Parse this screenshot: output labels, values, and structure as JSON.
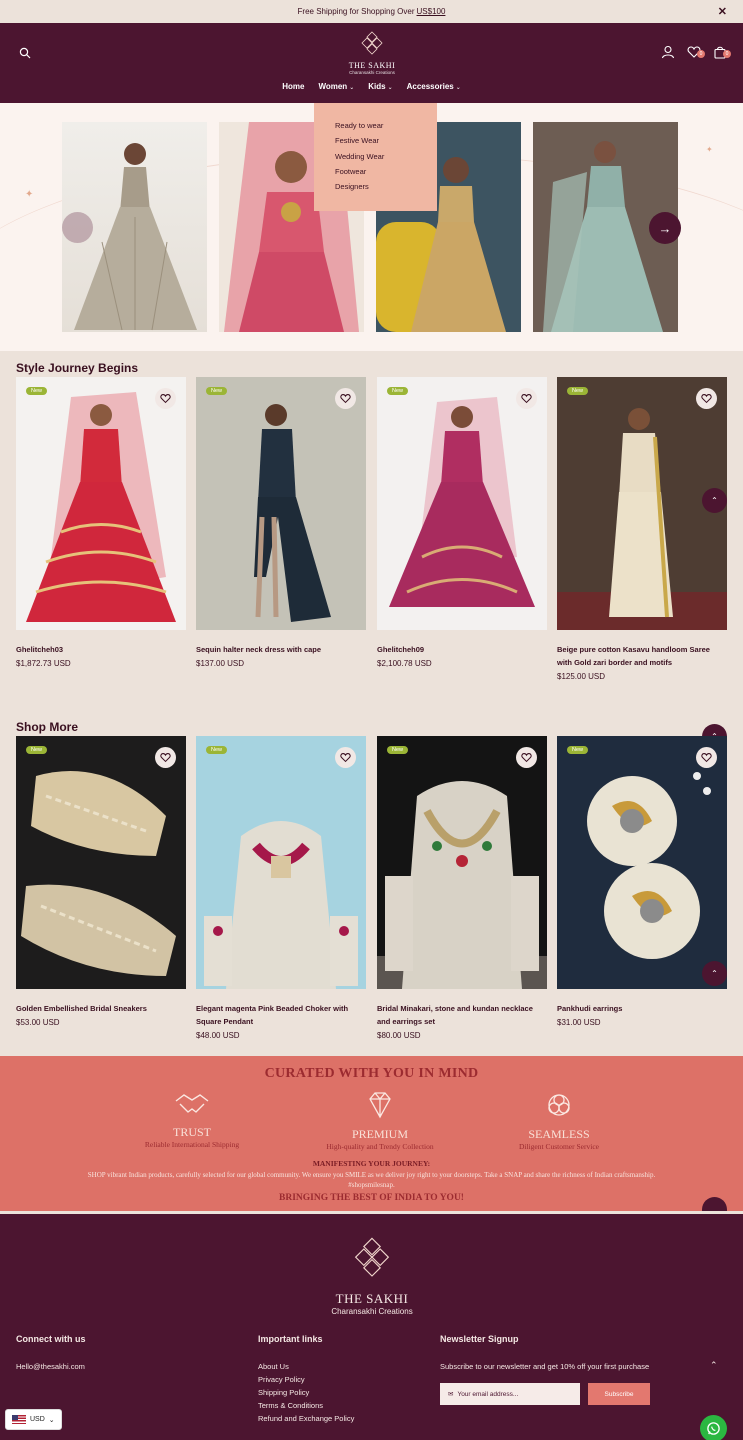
{
  "announcement": {
    "text": "Free Shipping for Shopping Over",
    "link": "US$100"
  },
  "brand": {
    "name": "THE SAKHI",
    "tagline": "Charansakhi Creations"
  },
  "header": {
    "wishlist_count": "0",
    "cart_count": "0"
  },
  "nav": [
    {
      "label": "Home",
      "has_caret": false
    },
    {
      "label": "Women",
      "has_caret": true
    },
    {
      "label": "Kids",
      "has_caret": true
    },
    {
      "label": "Accessories",
      "has_caret": true
    }
  ],
  "dropdown": [
    "Ready to wear",
    "Festive Wear",
    "Wedding Wear",
    "Footwear",
    "Designers"
  ],
  "sections": {
    "style_journey": "Style Journey Begins",
    "shop_more": "Shop More"
  },
  "badge_new": "New",
  "products_style": [
    {
      "name": "Ghelitcheh03",
      "price": "$1,872.73 USD"
    },
    {
      "name": "Sequin halter neck dress with cape",
      "price": "$137.00 USD"
    },
    {
      "name": "Ghelitcheh09",
      "price": "$2,100.78 USD"
    },
    {
      "name": "Beige pure cotton Kasavu handloom Saree with Gold zari border and motifs",
      "price": "$125.00 USD"
    }
  ],
  "products_shop": [
    {
      "name": "Golden Embellished Bridal Sneakers",
      "price": "$53.00 USD"
    },
    {
      "name": "Elegant magenta Pink Beaded Choker with Square Pendant",
      "price": "$48.00 USD"
    },
    {
      "name": "Bridal Minakari, stone and kundan necklace and earrings set",
      "price": "$80.00 USD"
    },
    {
      "name": "Pankhudi earrings",
      "price": "$31.00 USD"
    }
  ],
  "curated": {
    "title": "CURATED WITH YOU IN MIND",
    "features": [
      {
        "title": "TRUST",
        "sub": "Reliable International Shipping",
        "icon": "handshake-icon"
      },
      {
        "title": "PREMIUM",
        "sub": "High-quality and Trendy Collection",
        "icon": "diamond-icon"
      },
      {
        "title": "SEAMLESS",
        "sub": "Diligent Customer Service",
        "icon": "knot-icon"
      }
    ],
    "manifesting": "MANIFESTING YOUR JOURNEY:",
    "description": "SHOP vibrant Indian products, carefully selected for our global community. We ensure you SMILE as we deliver joy right to your doorsteps. Take a SNAP and share the richness of Indian craftsmanship.",
    "hashtag": "#shopsmilesnap.",
    "tagline": "BRINGING THE BEST OF INDIA TO YOU!"
  },
  "footer": {
    "connect_title": "Connect with us",
    "email": "Hello@thesakhi.com",
    "links_title": "Important links",
    "links": [
      "About Us",
      "Privacy Policy",
      "Shipping Policy",
      "Terms & Conditions",
      "Refund and Exchange Policy"
    ],
    "newsletter_title": "Newsletter Signup",
    "newsletter_text": "Subscribe to our newsletter and get 10% off your first purchase",
    "email_placeholder": "Your email address...",
    "subscribe_label": "Subscribe"
  },
  "currency": "USD",
  "colors": {
    "primary": "#4c1530",
    "accent": "#dd7167",
    "background": "#ece2da",
    "dropdown": "#f0b7a3",
    "new_badge": "#9bb536"
  }
}
